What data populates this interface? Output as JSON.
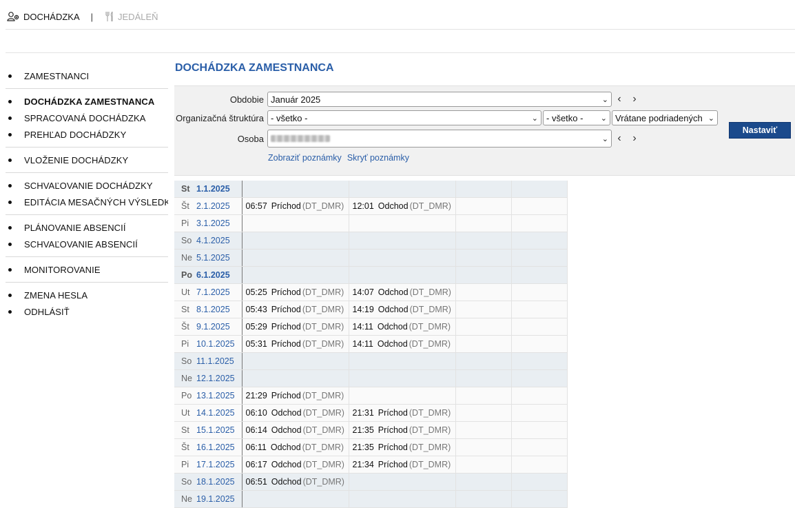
{
  "topbar": {
    "app1": "DOCHÁDZKA",
    "separator": "|",
    "app2": "JEDÁLEŇ"
  },
  "sidebar": {
    "groups": [
      [
        "ZAMESTNANCI"
      ],
      [
        "DOCHÁDZKA ZAMESTNANCA",
        "SPRACOVANÁ DOCHÁDZKA",
        "PREHĽAD DOCHÁDZKY"
      ],
      [
        "VLOŽENIE DOCHÁDZKY"
      ],
      [
        "SCHVAĽOVANIE DOCHÁDZKY",
        "EDITÁCIA MESAČNÝCH VÝSLEDKOV"
      ],
      [
        "PLÁNOVANIE ABSENCIÍ",
        "SCHVAĽOVANIE ABSENCIÍ"
      ],
      [
        "MONITOROVANIE"
      ],
      [
        "ZMENA HESLA",
        "ODHLÁSIŤ"
      ]
    ],
    "active": "DOCHÁDZKA ZAMESTNANCA"
  },
  "page_title": "DOCHÁDZKA ZAMESTNANCA",
  "filter": {
    "obdobie_label": "Obdobie",
    "obdobie_value": "Január 2025",
    "org_label": "Organizačná štruktúra",
    "org_value": "- všetko -",
    "org_sub_value": "- všetko -",
    "scope_value": "Vrátane podriadených",
    "osoba_label": "Osoba",
    "show_notes": "Zobraziť poznámky",
    "hide_notes": "Skryť poznámky",
    "set_button": "Nastaviť"
  },
  "attendance": [
    {
      "day": "St",
      "date": "1.1.2025",
      "kind": "weekend",
      "bold": true,
      "events": []
    },
    {
      "day": "Št",
      "date": "2.1.2025",
      "kind": "work",
      "events": [
        {
          "time": "06:57",
          "type": "Príchod",
          "src": "(DT_DMR)"
        },
        {
          "time": "12:01",
          "type": "Odchod",
          "src": "(DT_DMR)"
        }
      ]
    },
    {
      "day": "Pi",
      "date": "3.1.2025",
      "kind": "work",
      "events": []
    },
    {
      "day": "So",
      "date": "4.1.2025",
      "kind": "weekend",
      "events": []
    },
    {
      "day": "Ne",
      "date": "5.1.2025",
      "kind": "weekend",
      "events": []
    },
    {
      "day": "Po",
      "date": "6.1.2025",
      "kind": "weekend",
      "bold": true,
      "events": []
    },
    {
      "day": "Ut",
      "date": "7.1.2025",
      "kind": "work",
      "events": [
        {
          "time": "05:25",
          "type": "Príchod",
          "src": "(DT_DMR)"
        },
        {
          "time": "14:07",
          "type": "Odchod",
          "src": "(DT_DMR)"
        }
      ]
    },
    {
      "day": "St",
      "date": "8.1.2025",
      "kind": "work",
      "events": [
        {
          "time": "05:43",
          "type": "Príchod",
          "src": "(DT_DMR)"
        },
        {
          "time": "14:19",
          "type": "Odchod",
          "src": "(DT_DMR)"
        }
      ]
    },
    {
      "day": "Št",
      "date": "9.1.2025",
      "kind": "work",
      "events": [
        {
          "time": "05:29",
          "type": "Príchod",
          "src": "(DT_DMR)"
        },
        {
          "time": "14:11",
          "type": "Odchod",
          "src": "(DT_DMR)"
        }
      ]
    },
    {
      "day": "Pi",
      "date": "10.1.2025",
      "kind": "work",
      "events": [
        {
          "time": "05:31",
          "type": "Príchod",
          "src": "(DT_DMR)"
        },
        {
          "time": "14:11",
          "type": "Odchod",
          "src": "(DT_DMR)"
        }
      ]
    },
    {
      "day": "So",
      "date": "11.1.2025",
      "kind": "weekend",
      "events": []
    },
    {
      "day": "Ne",
      "date": "12.1.2025",
      "kind": "weekend",
      "events": []
    },
    {
      "day": "Po",
      "date": "13.1.2025",
      "kind": "work",
      "events": [
        {
          "time": "21:29",
          "type": "Príchod",
          "src": "(DT_DMR)"
        }
      ]
    },
    {
      "day": "Ut",
      "date": "14.1.2025",
      "kind": "work",
      "events": [
        {
          "time": "06:10",
          "type": "Odchod",
          "src": "(DT_DMR)"
        },
        {
          "time": "21:31",
          "type": "Príchod",
          "src": "(DT_DMR)"
        }
      ]
    },
    {
      "day": "St",
      "date": "15.1.2025",
      "kind": "work",
      "events": [
        {
          "time": "06:14",
          "type": "Odchod",
          "src": "(DT_DMR)"
        },
        {
          "time": "21:35",
          "type": "Príchod",
          "src": "(DT_DMR)"
        }
      ]
    },
    {
      "day": "Št",
      "date": "16.1.2025",
      "kind": "work",
      "events": [
        {
          "time": "06:11",
          "type": "Odchod",
          "src": "(DT_DMR)"
        },
        {
          "time": "21:35",
          "type": "Príchod",
          "src": "(DT_DMR)"
        }
      ]
    },
    {
      "day": "Pi",
      "date": "17.1.2025",
      "kind": "work",
      "events": [
        {
          "time": "06:17",
          "type": "Odchod",
          "src": "(DT_DMR)"
        },
        {
          "time": "21:34",
          "type": "Príchod",
          "src": "(DT_DMR)"
        }
      ]
    },
    {
      "day": "So",
      "date": "18.1.2025",
      "kind": "weekend",
      "events": [
        {
          "time": "06:51",
          "type": "Odchod",
          "src": "(DT_DMR)"
        }
      ]
    },
    {
      "day": "Ne",
      "date": "19.1.2025",
      "kind": "weekend",
      "events": []
    }
  ],
  "colors": {
    "accent": "#2a5ea8",
    "button": "#1b4a8c",
    "weekend_row": "#e9eef2"
  }
}
